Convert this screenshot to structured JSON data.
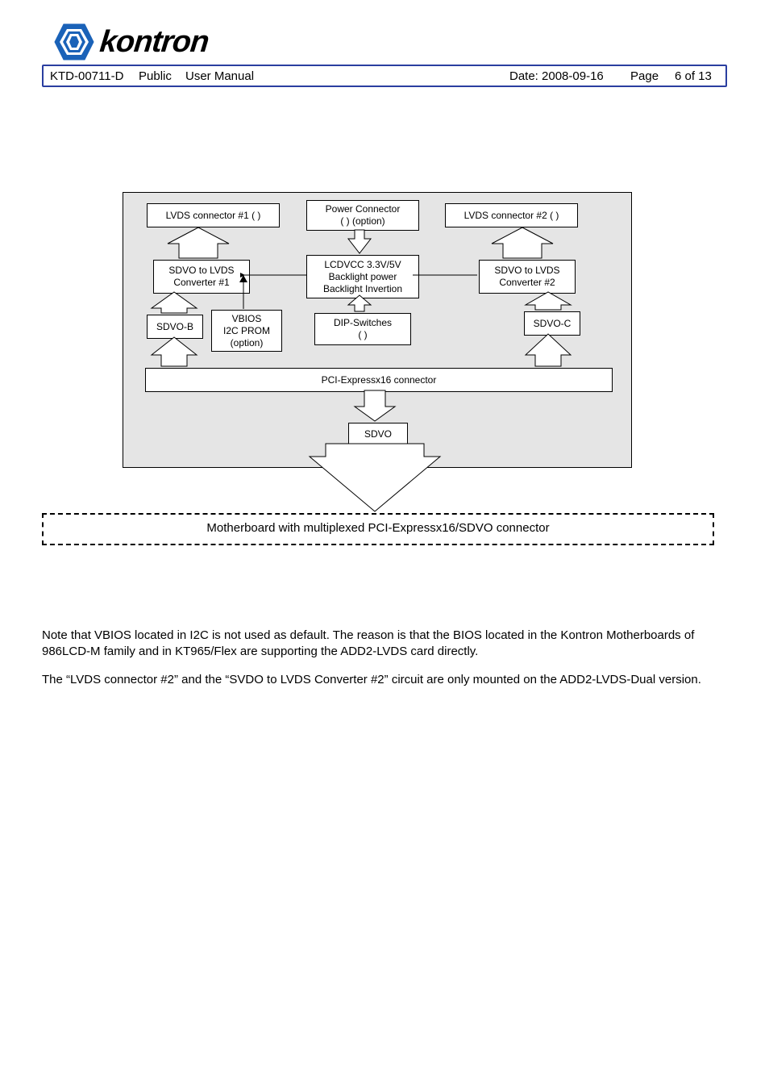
{
  "header": {
    "doc_id": "KTD-00711-D",
    "public": "Public",
    "user_manual": "User Manual",
    "date_label": "Date: 2008-09-16",
    "page_label": "Page",
    "page_num": "6 of 13"
  },
  "logo": {
    "brand": "kontron"
  },
  "diagram": {
    "lvds1": "LVDS connector #1 (    )",
    "power_conn_l1": "Power Connector",
    "power_conn_l2": "(       ) (option)",
    "lvds2": "LVDS connector #2 (    )",
    "conv1_l1": "SDVO to LVDS",
    "conv1_l2": "Converter #1",
    "lcd_l1": "LCDVCC 3.3V/5V",
    "lcd_l2": "Backlight power",
    "lcd_l3": "Backlight Invertion",
    "conv2_l1": "SDVO to LVDS",
    "conv2_l2": "Converter #2",
    "sdvo_b": "SDVO-B",
    "vbios_l1": "VBIOS",
    "vbios_l2": "I2C PROM",
    "vbios_l3": "(option)",
    "dip_l1": "DIP-Switches",
    "dip_l2": "(           )",
    "sdvo_c": "SDVO-C",
    "pcie": "PCI-Expressx16 connector",
    "sdvo": "SDVO",
    "mb": "Motherboard with multiplexed PCI-Expressx16/SDVO connector"
  },
  "body": {
    "p1": "Note that VBIOS located in I2C is not used as default. The reason is that the BIOS located in the Kontron Motherboards of 986LCD-M family and in KT965/Flex are supporting the ADD2-LVDS card directly.",
    "p2": "The “LVDS connector #2” and the “SVDO to LVDS Converter #2” circuit are only mounted on the ADD2-LVDS-Dual version."
  }
}
